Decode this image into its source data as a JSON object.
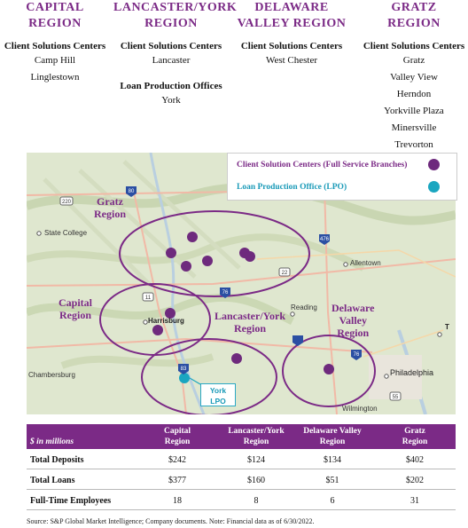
{
  "regions": [
    {
      "name_line1": "CAPITAL",
      "name_line2": "REGION",
      "csc_header": "Client Solutions Centers",
      "csc_locations": [
        "Camp Hill",
        "Linglestown"
      ]
    },
    {
      "name_line1": "LANCASTER/YORK",
      "name_line2": "REGION",
      "csc_header": "Client Solutions Centers",
      "csc_locations": [
        "Lancaster"
      ],
      "lpo_header": "Loan Production Offices",
      "lpo_locations": [
        "York"
      ]
    },
    {
      "name_line1": "DELAWARE",
      "name_line2": "VALLEY REGION",
      "csc_header": "Client Solutions Centers",
      "csc_locations": [
        "West Chester"
      ]
    },
    {
      "name_line1": "GRATZ",
      "name_line2": "REGION",
      "csc_header": "Client Solutions Centers",
      "csc_locations": [
        "Gratz",
        "Valley View",
        "Herndon",
        "Yorkville Plaza",
        "Minersville",
        "Trevorton"
      ]
    }
  ],
  "map": {
    "legend": {
      "csc_label": "Client Solution Centers (Full Service Branches)",
      "lpo_label": "Loan Production Office (LPO)"
    },
    "region_labels": {
      "gratz": [
        "Gratz",
        "Region"
      ],
      "capital": [
        "Capital",
        "Region"
      ],
      "lancaster": [
        "Lancaster/York",
        "Region"
      ],
      "delaware": [
        "Delaware",
        "Valley",
        "Region"
      ]
    },
    "city_labels": {
      "state_college": "State College",
      "allentown": "Allentown",
      "harrisburg": "Harrisburg",
      "reading": "Reading",
      "chambersburg": "Chambersburg",
      "philadelphia": "Philadelphia",
      "wilmington": "Wilmington",
      "partial_t": "T"
    },
    "shields": {
      "i80": "80",
      "us220": "220",
      "i476": "476",
      "us22": "22",
      "i76": "76",
      "us11": "11",
      "i76b": "76",
      "i83": "83",
      "us55": "55"
    },
    "lpo_callout": [
      "York",
      "LPO"
    ],
    "colors": {
      "csc_dot": "#6e2a7d",
      "lpo_dot": "#1aa6c0",
      "region_outline": "#7b2a86"
    }
  },
  "table": {
    "unit_label": "$ in millions",
    "columns": [
      [
        "Capital",
        "Region"
      ],
      [
        "Lancaster/York",
        "Region"
      ],
      [
        "Delaware Valley",
        "Region"
      ],
      [
        "Gratz",
        "Region"
      ]
    ],
    "rows": [
      {
        "label": "Total Deposits",
        "values": [
          "$242",
          "$124",
          "$134",
          "$402"
        ]
      },
      {
        "label": "Total Loans",
        "values": [
          "$377",
          "$160",
          "$51",
          "$202"
        ]
      },
      {
        "label": "Full-Time Employees",
        "values": [
          "18",
          "8",
          "6",
          "31"
        ]
      }
    ],
    "header_color": "#7b2a86"
  },
  "source": "Source: S&P Global Market Intelligence; Company documents. Note: Financial data as of 6/30/2022."
}
